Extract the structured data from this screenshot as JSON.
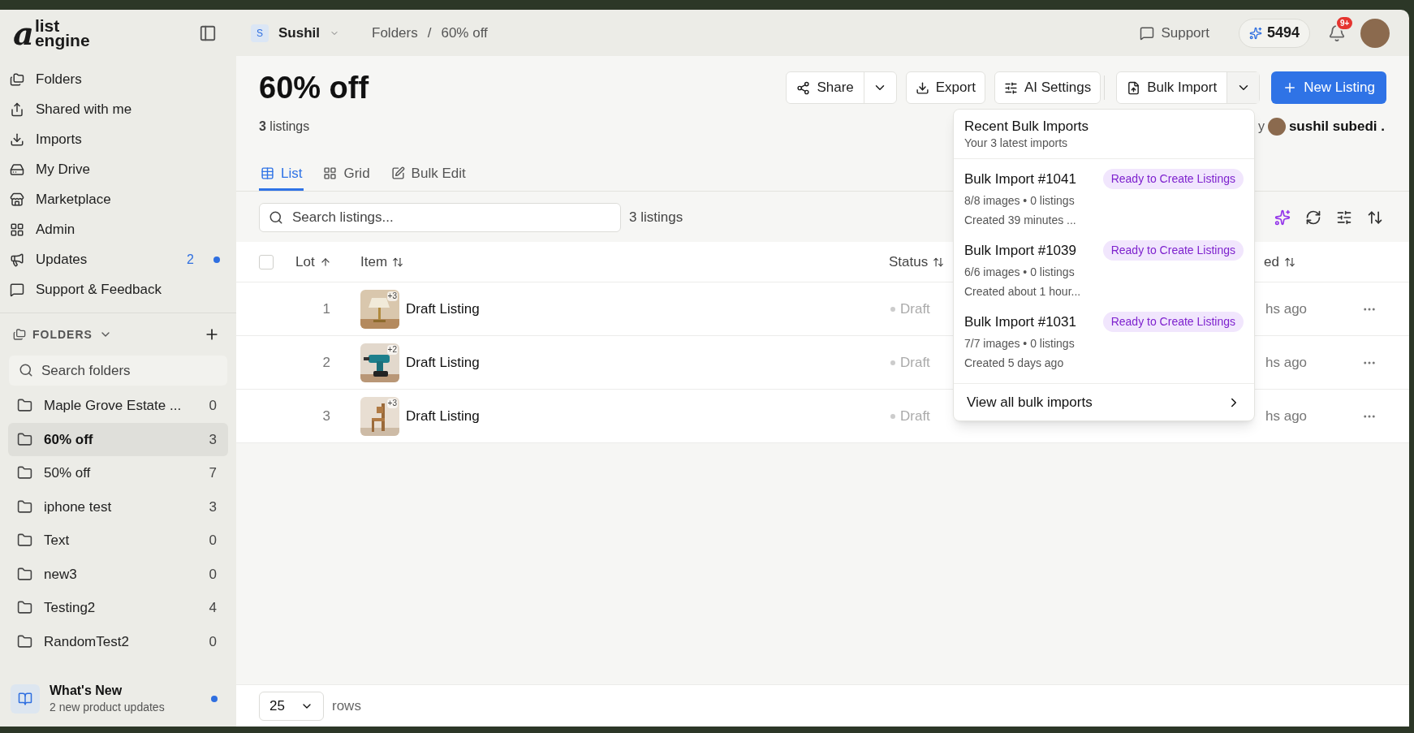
{
  "logo": {
    "mark": "a",
    "line1": "list",
    "line2": "engine"
  },
  "workspace": {
    "initial": "S",
    "name": "Sushil"
  },
  "breadcrumb": [
    "Folders",
    "60% off"
  ],
  "breadcrumb_separator": "/",
  "header": {
    "support": "Support",
    "credits": "5494",
    "notification_badge": "9+"
  },
  "nav": [
    {
      "label": "Folders"
    },
    {
      "label": "Shared with me"
    },
    {
      "label": "Imports"
    },
    {
      "label": "My Drive"
    },
    {
      "label": "Marketplace"
    },
    {
      "label": "Admin"
    },
    {
      "label": "Updates",
      "badge": "2",
      "unread": true
    },
    {
      "label": "Support & Feedback"
    }
  ],
  "folders_section": {
    "title": "FOLDERS",
    "expanded": true,
    "search_placeholder": "Search folders",
    "items": [
      {
        "name": "Maple Grove Estate ...",
        "count": "0",
        "selected": false
      },
      {
        "name": "60% off",
        "count": "3",
        "selected": true
      },
      {
        "name": "50% off",
        "count": "7",
        "selected": false
      },
      {
        "name": "iphone test",
        "count": "3",
        "selected": false
      },
      {
        "name": "Text",
        "count": "0",
        "selected": false
      },
      {
        "name": "new3",
        "count": "0",
        "selected": false
      },
      {
        "name": "Testing2",
        "count": "4",
        "selected": false
      },
      {
        "name": "RandomTest2",
        "count": "0",
        "selected": false
      }
    ]
  },
  "whats_new": {
    "title": "What's New",
    "subtitle": "2 new product updates",
    "unread": true
  },
  "page": {
    "title": "60% off",
    "count_line": "**3** listings",
    "owner_fragment": "y",
    "owner": "sushil subedi ."
  },
  "actions": [
    {
      "kind": "split",
      "label": "Share"
    },
    {
      "kind": "plain",
      "label": "Export"
    },
    {
      "kind": "plain",
      "label": "AI Settings"
    },
    {
      "kind": "separator"
    },
    {
      "kind": "split",
      "label": "Bulk Import",
      "expanded": true
    },
    {
      "kind": "primary",
      "label": "New Listing"
    }
  ],
  "view_tabs": [
    {
      "label": "List",
      "selected": true
    },
    {
      "label": "Grid",
      "selected": false
    },
    {
      "label": "Bulk Edit",
      "selected": false
    }
  ],
  "search": {
    "placeholder": "Search listings...",
    "result_count": "3 listings"
  },
  "table": {
    "select_all_checked": false,
    "columns": [
      {
        "label": "Lot",
        "sorted": true
      },
      {
        "label": "Item",
        "sorted": false
      },
      {
        "label": "Status",
        "sorted": false
      },
      {
        "label": "ed",
        "sorted": false
      }
    ],
    "rows": [
      {
        "lot": "1",
        "photo_count": "+3",
        "item": "Draft Listing",
        "status": "Draft",
        "column_4": "hs ago"
      },
      {
        "lot": "2",
        "photo_count": "+2",
        "item": "Draft Listing",
        "status": "Draft",
        "column_4": "hs ago"
      },
      {
        "lot": "3",
        "photo_count": "+3",
        "item": "Draft Listing",
        "status": "Draft",
        "column_4": "hs ago"
      }
    ]
  },
  "bulk_imports_menu": {
    "title": "Recent Bulk Imports",
    "subtitle": "Your 3 latest imports",
    "items": [
      {
        "name": "Bulk Import #1041",
        "status": "Ready to Create Listings",
        "details": "8/8 images • 0 listings",
        "created": "Created 39 minutes ..."
      },
      {
        "name": "Bulk Import #1039",
        "status": "Ready to Create Listings",
        "details": "6/6 images • 0 listings",
        "created": "Created about 1 hour..."
      },
      {
        "name": "Bulk Import #1031",
        "status": "Ready to Create Listings",
        "details": "7/7 images • 0 listings",
        "created": "Created 5 days ago"
      }
    ],
    "footer": "View all bulk imports"
  },
  "pagination": {
    "rows_per_page": "25",
    "label": "rows"
  }
}
